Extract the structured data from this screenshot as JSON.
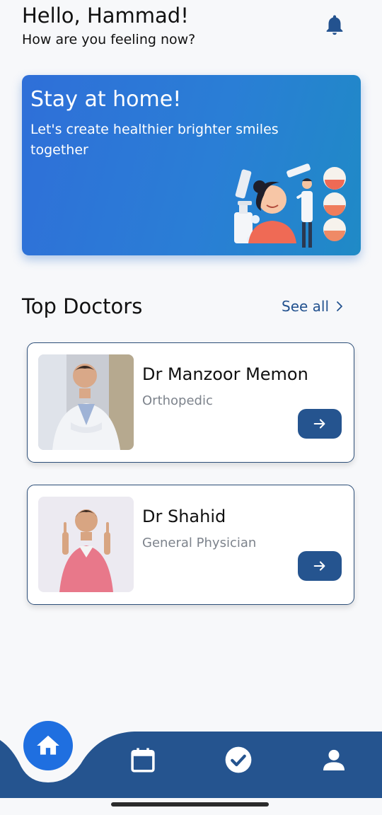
{
  "header": {
    "greeting": "Hello, Hammad!",
    "subtitle": "How are you feeling now?"
  },
  "banner": {
    "title": "Stay at home!",
    "text": "Let's create healthier brighter smiles together"
  },
  "section": {
    "title": "Top Doctors",
    "see_all": "See all"
  },
  "doctors": [
    {
      "name": "Dr Manzoor Memon",
      "specialty": "Orthopedic"
    },
    {
      "name": "Dr Shahid",
      "specialty": "General Physician"
    }
  ],
  "nav": {
    "items": [
      "home-icon",
      "calendar-icon",
      "check-circle-icon",
      "person-icon"
    ],
    "active": "home-icon"
  },
  "colors": {
    "primary": "#25548f",
    "accent": "#1f6fe0",
    "background": "#f7f8fa"
  }
}
